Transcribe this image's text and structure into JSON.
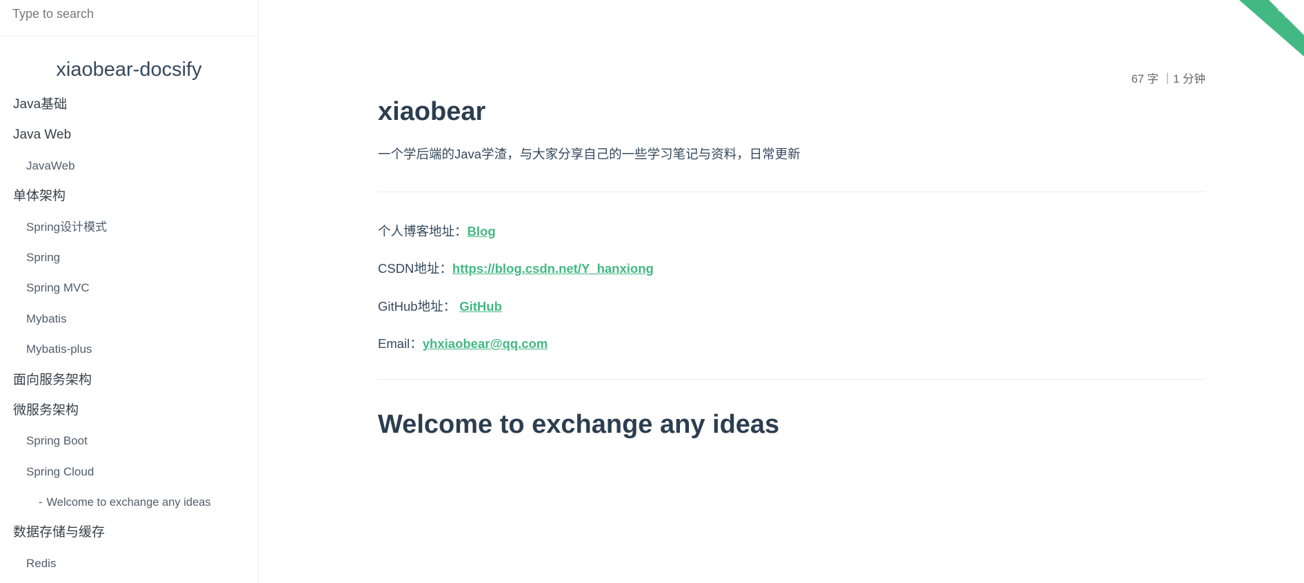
{
  "search": {
    "placeholder": "Type to search"
  },
  "sidebar": {
    "app_name": "xiaobear-docsify",
    "items": [
      {
        "label": "Java基础",
        "level": 0
      },
      {
        "label": "Java Web",
        "level": 0
      },
      {
        "label": "JavaWeb",
        "level": 1
      },
      {
        "label": "单体架构",
        "level": 0
      },
      {
        "label": "Spring设计模式",
        "level": 1
      },
      {
        "label": "Spring",
        "level": 1
      },
      {
        "label": "Spring MVC",
        "level": 1
      },
      {
        "label": "Mybatis",
        "level": 1
      },
      {
        "label": "Mybatis-plus",
        "level": 1
      },
      {
        "label": "面向服务架构",
        "level": 0
      },
      {
        "label": "微服务架构",
        "level": 0
      },
      {
        "label": "Spring Boot",
        "level": 1
      },
      {
        "label": "Spring Cloud",
        "level": 1
      },
      {
        "label": "Welcome to exchange any ideas",
        "level": 2
      },
      {
        "label": "数据存储与缓存",
        "level": 0
      },
      {
        "label": "Redis",
        "level": 1
      }
    ]
  },
  "main": {
    "meta": "67 字 ｜1 分钟",
    "title": "xiaobear",
    "intro": "一个学后端的Java学渣，与大家分享自己的一些学习笔记与资料，日常更新",
    "links": [
      {
        "label": "个人博客地址：",
        "link_text": "Blog"
      },
      {
        "label": "CSDN地址：",
        "link_text": "https://blog.csdn.net/Y_hanxiong"
      },
      {
        "label": "GitHub地址： ",
        "link_text": "GitHub"
      },
      {
        "label": "Email：",
        "link_text": "yhxiaobear@qq.com"
      }
    ],
    "heading2": "Welcome to exchange any ideas"
  },
  "corner": {
    "icon": "github-octocat-icon",
    "color": "#42b983"
  },
  "colors": {
    "accent": "#42b983",
    "text": "#34495e",
    "heading": "#2c3e50"
  }
}
